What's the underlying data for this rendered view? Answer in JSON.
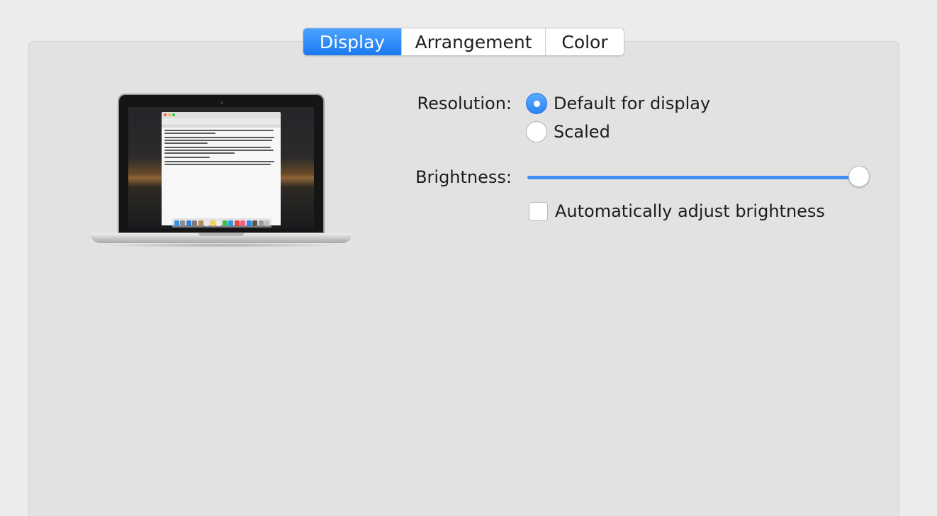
{
  "tabs": [
    {
      "label": "Display",
      "selected": true
    },
    {
      "label": "Arrangement",
      "selected": false
    },
    {
      "label": "Color",
      "selected": false
    }
  ],
  "resolution": {
    "label": "Resolution:",
    "options": [
      {
        "label": "Default for display",
        "selected": true
      },
      {
        "label": "Scaled",
        "selected": false
      }
    ]
  },
  "brightness": {
    "label": "Brightness:",
    "value_fraction": 1.0
  },
  "auto_brightness": {
    "label": "Automatically adjust brightness",
    "checked": false
  },
  "colors": {
    "accent": "#2b84f5",
    "panel": "#e2e2e2",
    "window": "#ececec"
  }
}
